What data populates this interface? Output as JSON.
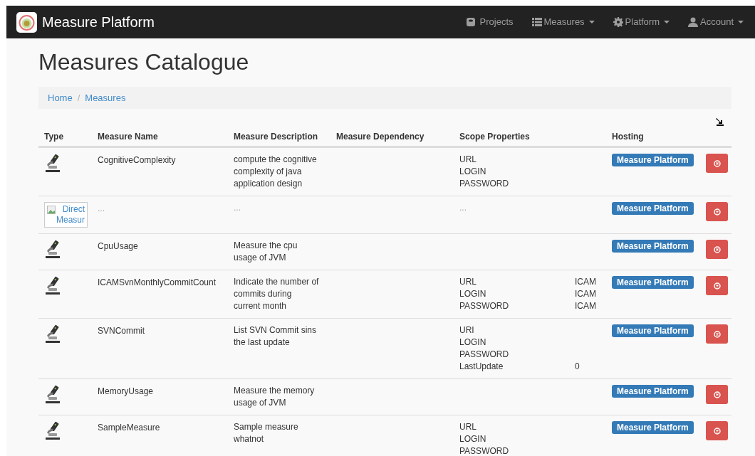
{
  "navbar": {
    "brand": "Measure Platform",
    "items": [
      {
        "label": "Projects",
        "kind": "drive",
        "dropdown": false
      },
      {
        "label": "Measures",
        "kind": "list",
        "dropdown": true
      },
      {
        "label": "Platform",
        "kind": "gear",
        "dropdown": true
      },
      {
        "label": "Account",
        "kind": "user",
        "dropdown": true
      }
    ]
  },
  "page": {
    "title": "Measures Catalogue",
    "breadcrumb": [
      {
        "label": "Home"
      },
      {
        "separator": "/",
        "label": "Measures"
      }
    ]
  },
  "table": {
    "columns": [
      "Type",
      "Measure Name",
      "Measure Description",
      "Measure Dependency",
      "Scope Properties",
      "Hosting"
    ],
    "rows": [
      {
        "type": {
          "kind": "microscope"
        },
        "name": "CognitiveComplexity",
        "description": [
          "compute the cognitive",
          "complexity of java",
          "application design"
        ],
        "dependency": "",
        "scope": [
          {
            "name": "URL"
          },
          {
            "name": "LOGIN"
          },
          {
            "name": "PASSWORD"
          }
        ],
        "hosting": "Measure Platform"
      },
      {
        "type": {
          "kind": "broken-image",
          "alt": "Direct Measur"
        },
        "name": "...",
        "description": [
          "..."
        ],
        "dependency": "",
        "scope": [
          {
            "name": "...",
            "faint": true
          }
        ],
        "hosting": "Measure Platform",
        "faint": true
      },
      {
        "type": {
          "kind": "microscope"
        },
        "name": "CpuUsage",
        "description": [
          "Measure the cpu",
          "usage of JVM"
        ],
        "scope": [],
        "hosting": "Measure Platform"
      },
      {
        "type": {
          "kind": "microscope"
        },
        "name": "ICAMSvnMonthlyCommitCount",
        "description": [
          "Indicate the number of",
          "commits during",
          "current month"
        ],
        "scope": [
          {
            "name": "URL",
            "value": "ICAM"
          },
          {
            "name": "LOGIN",
            "value": "ICAM"
          },
          {
            "name": "PASSWORD",
            "value": "ICAM"
          }
        ],
        "hosting": "Measure Platform"
      },
      {
        "type": {
          "kind": "microscope"
        },
        "name": "SVNCommit",
        "description": [
          "List SVN Commit sins",
          "the last update"
        ],
        "scope": [
          {
            "name": "URI"
          },
          {
            "name": "LOGIN"
          },
          {
            "name": "PASSWORD"
          },
          {
            "name": "LastUpdate",
            "value": "0"
          }
        ],
        "hosting": "Measure Platform"
      },
      {
        "type": {
          "kind": "microscope"
        },
        "name": "MemoryUsage",
        "description": [
          "Measure the memory",
          "usage of JVM"
        ],
        "scope": [],
        "hosting": "Measure Platform"
      },
      {
        "type": {
          "kind": "microscope"
        },
        "name": "SampleMeasure",
        "description": [
          "Sample measure",
          "whatnot"
        ],
        "scope": [
          {
            "name": "URL"
          },
          {
            "name": "LOGIN"
          },
          {
            "name": "PASSWORD"
          }
        ],
        "hosting": "Measure Platform"
      }
    ]
  }
}
